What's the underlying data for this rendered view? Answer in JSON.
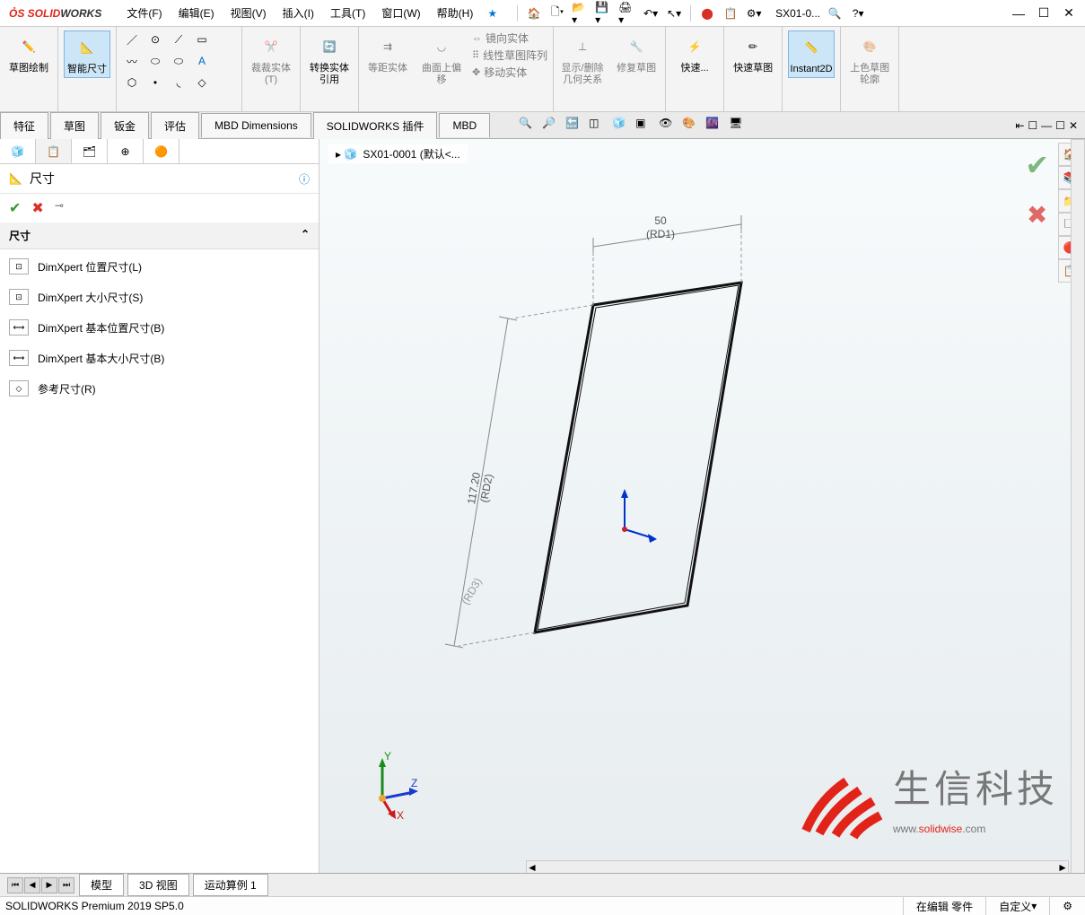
{
  "app": {
    "brand_prefix": "SOLID",
    "brand_suffix": "WORKS",
    "doc": "SX01-0..."
  },
  "menu": [
    "文件(F)",
    "编辑(E)",
    "视图(V)",
    "插入(I)",
    "工具(T)",
    "窗口(W)",
    "帮助(H)"
  ],
  "ribbon": {
    "sketch_draw": "草图绘制",
    "smart_dim": "智能尺寸",
    "trim": "裁裁实体(T)",
    "convert": "转换实体引用",
    "offset": "等距实体",
    "surface_offset": "曲面上偏移",
    "mirror": "镜向实体",
    "linear_pattern": "线性草图阵列",
    "move": "移动实体",
    "show_rel": "显示/删除几何关系",
    "repair": "修复草图",
    "quick": "快速...",
    "quick_sketch": "快速草图",
    "instant2d": "Instant2D",
    "shade_outline": "上色草图轮廓"
  },
  "tabs": [
    "特征",
    "草图",
    "钣金",
    "评估",
    "MBD Dimensions",
    "SOLIDWORKS 插件",
    "MBD"
  ],
  "breadcrumb": "SX01-0001 (默认<...",
  "panel": {
    "title": "尺寸",
    "section": "尺寸",
    "items": [
      "DimXpert 位置尺寸(L)",
      "DimXpert 大小尺寸(S)",
      "DimXpert 基本位置尺寸(B)",
      "DimXpert 基本大小尺寸(B)",
      "参考尺寸(R)"
    ]
  },
  "dims": {
    "w": "50",
    "w_sub": "(RD1)",
    "h": "117.20",
    "h_sub": "(RD2)",
    "extra": "(RD3)"
  },
  "watermark": {
    "cn": "生信科技",
    "url_pre": "www.",
    "url_mid": "solidwise",
    "url_suf": ".com"
  },
  "bottom_tabs": [
    "模型",
    "3D 视图",
    "运动算例 1"
  ],
  "status": {
    "left": "SOLIDWORKS Premium 2019 SP5.0",
    "mode": "在编辑 零件",
    "view": "自定义"
  }
}
